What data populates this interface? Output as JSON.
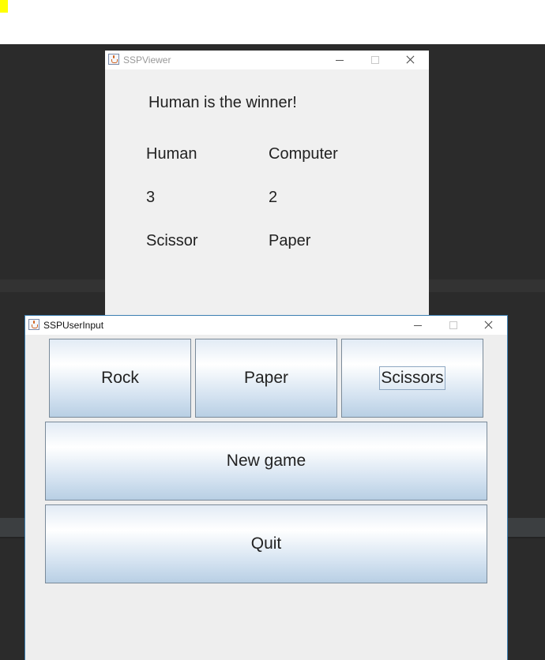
{
  "viewer_window": {
    "title": "SSPViewer",
    "result_text": "Human is the winner!",
    "human_header": "Human",
    "computer_header": "Computer",
    "human_score": "3",
    "computer_score": "2",
    "human_choice": "Scissor",
    "computer_choice": "Paper"
  },
  "input_window": {
    "title": "SSPUserInput",
    "rock_label": "Rock",
    "paper_label": "Paper",
    "scissors_label": "Scissors",
    "new_game_label": "New game",
    "quit_label": "Quit"
  },
  "colors": {
    "window_background": "#f0f0f0",
    "button_gradient_top": "#ffffff",
    "button_gradient_bottom": "#b8cfe4",
    "active_window_border": "#3c7fb1",
    "desktop": "#2b2b2b"
  },
  "icons": [
    "java-app-icon",
    "minimize-icon",
    "maximize-icon",
    "close-icon"
  ]
}
